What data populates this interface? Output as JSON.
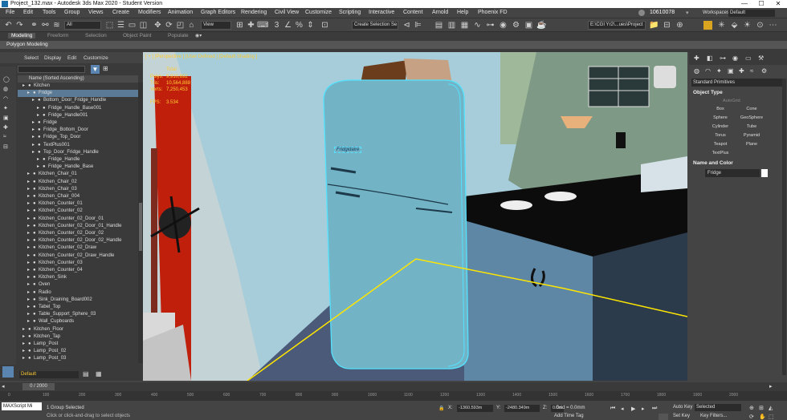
{
  "window": {
    "title": "Project_132.max - Autodesk 3ds Max 2020 - Student Version",
    "minimize": "—",
    "maximize": "☐",
    "close": "✕"
  },
  "menu": {
    "items": [
      "File",
      "Edit",
      "Tools",
      "Group",
      "Views",
      "Create",
      "Modifiers",
      "Animation",
      "Graph Editors",
      "Rendering",
      "Civil View",
      "Customize",
      "Scripting",
      "Interactive",
      "Content",
      "Arnold",
      "Help",
      "Phoenix FD"
    ],
    "user_id": "10610078",
    "workspaces_label": "Workspaces:",
    "workspaces_value": "Default"
  },
  "toolbar": {
    "filter_value": "All",
    "view_value": "View",
    "selection_set_placeholder": "Create Selection Se",
    "project_path": "E:\\CGI Yr2\\...ues\\Project"
  },
  "ribbon": {
    "tabs": [
      "Modeling",
      "Freeform",
      "Selection",
      "Object Paint",
      "Populate"
    ],
    "active_tab": "Modeling",
    "sub_label": "Polygon Modeling"
  },
  "explorer": {
    "tabs": [
      "Select",
      "Display",
      "Edit",
      "Customize"
    ],
    "column_header": "Name (Sorted Ascending)",
    "items": [
      {
        "name": "Kitchen",
        "level": 1
      },
      {
        "name": "Fridge",
        "level": 2,
        "selected": true
      },
      {
        "name": "Bottom_Door_Fridge_Handle",
        "level": 3
      },
      {
        "name": "Fridge_Handle_Base001",
        "level": 4
      },
      {
        "name": "Fridge_Handle001",
        "level": 4
      },
      {
        "name": "Fridge",
        "level": 3
      },
      {
        "name": "Fridge_Bottom_Door",
        "level": 3
      },
      {
        "name": "Fridge_Top_Door",
        "level": 3
      },
      {
        "name": "TextPlus001",
        "level": 3
      },
      {
        "name": "Top_Door_Fridge_Handle",
        "level": 3
      },
      {
        "name": "Fridge_Handle",
        "level": 4
      },
      {
        "name": "Fridge_Handle_Base",
        "level": 4
      },
      {
        "name": "Kitchen_Chair_01",
        "level": 2
      },
      {
        "name": "Kitchen_Chair_02",
        "level": 2
      },
      {
        "name": "Kitchen_Chair_03",
        "level": 2
      },
      {
        "name": "Kitchen_Chair_004",
        "level": 2
      },
      {
        "name": "Kitchen_Counter_01",
        "level": 2
      },
      {
        "name": "Kitchen_Counter_02",
        "level": 2
      },
      {
        "name": "Kitchen_Counter_02_Door_01",
        "level": 2
      },
      {
        "name": "Kitchen_Counter_02_Door_01_Handle",
        "level": 2
      },
      {
        "name": "Kitchen_Counter_02_Door_02",
        "level": 2
      },
      {
        "name": "Kitchen_Counter_02_Door_02_Handle",
        "level": 2
      },
      {
        "name": "Kitchen_Counter_02_Draw",
        "level": 2
      },
      {
        "name": "Kitchen_Counter_02_Draw_Handle",
        "level": 2
      },
      {
        "name": "Kitchen_Counter_03",
        "level": 2
      },
      {
        "name": "Kitchen_Counter_04",
        "level": 2
      },
      {
        "name": "Kitchen_Sink",
        "level": 2
      },
      {
        "name": "Oven",
        "level": 2
      },
      {
        "name": "Radio",
        "level": 2
      },
      {
        "name": "Sink_Draining_Board002",
        "level": 2
      },
      {
        "name": "Tabel_Top",
        "level": 2
      },
      {
        "name": "Table_Support_Sphere_03",
        "level": 2
      },
      {
        "name": "Wall_Cupboards",
        "level": 2
      },
      {
        "name": "Kitchen_Floor",
        "level": 1
      },
      {
        "name": "Kitchen_Tap",
        "level": 1
      },
      {
        "name": "Lamp_Post",
        "level": 1
      },
      {
        "name": "Lamp_Post_02",
        "level": 1
      },
      {
        "name": "Lamp_Post_03",
        "level": 1
      }
    ],
    "layer_value": "Default"
  },
  "viewport": {
    "label": "[ + ] [Perspective ] [User Defined ] [Default Shading ]",
    "stats": {
      "total_label": "Total",
      "polys_label": "Polys:",
      "polys_value": "9,910,692",
      "tris_label": "Tris:",
      "tris_value": "10,564,888",
      "verts_label": "Verts:",
      "verts_value": "7,250,453",
      "fps_label": "FPS:",
      "fps_value": "3.534"
    },
    "fridge_text": "Fridgidaire"
  },
  "command_panel": {
    "dropdown_value": "Standard Primitives",
    "object_type_title": "Object Type",
    "autogrid_label": "AutoGrid",
    "buttons": [
      "Box",
      "Cone",
      "Sphere",
      "GeoSphere",
      "Cylinder",
      "Tube",
      "Torus",
      "Pyramid",
      "Teapot",
      "Plane",
      "TextPlus"
    ],
    "name_color_title": "Name and Color",
    "name_value": "Fridge"
  },
  "timeline": {
    "frame_value": "0 / 2000",
    "ticks": [
      "0",
      "100",
      "200",
      "300",
      "400",
      "500",
      "600",
      "700",
      "800",
      "900",
      "1000",
      "1100",
      "1200",
      "1300",
      "1400",
      "1500",
      "1600",
      "1700",
      "1800",
      "1900",
      "2000"
    ]
  },
  "status": {
    "script_value": "MAXScript Mi",
    "selection_text": "1 Group Selected",
    "prompt_text": "Click or click-and-drag to select objects",
    "x_label": "X:",
    "x_value": "-1360.593m",
    "y_label": "Y:",
    "y_value": "-2480.349m",
    "z_label": "Z:",
    "z_value": "0.0m",
    "grid_text": "Grid = 0.0mm",
    "add_time_tag": "Add Time Tag",
    "auto_key": "Auto Key",
    "set_key": "Set Key",
    "selected_value": "Selected",
    "key_filters": "Key Filters..."
  },
  "colors": {
    "accent_blue": "#5aa0d0",
    "fridge": "#79b6c9",
    "red_door": "#b8200c",
    "selection_yellow": "#ffe600"
  }
}
